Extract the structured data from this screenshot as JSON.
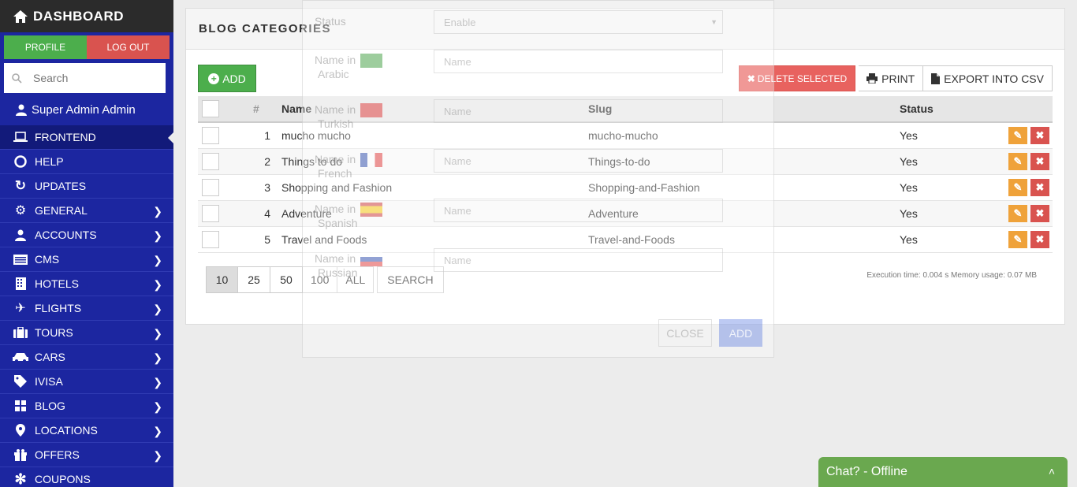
{
  "sidebar": {
    "title": "DASHBOARD",
    "profile_label": "PROFILE",
    "logout_label": "LOG OUT",
    "search_placeholder": "Search",
    "user_name": "Super Admin Admin",
    "items": [
      {
        "label": "FRONTEND",
        "icon": "laptop-icon"
      },
      {
        "label": "HELP",
        "icon": "lifebuoy-icon"
      },
      {
        "label": "UPDATES",
        "icon": "refresh-icon"
      },
      {
        "label": "GENERAL",
        "icon": "gears-icon"
      },
      {
        "label": "ACCOUNTS",
        "icon": "user-icon"
      },
      {
        "label": "CMS",
        "icon": "list-icon"
      },
      {
        "label": "HOTELS",
        "icon": "building-icon"
      },
      {
        "label": "FLIGHTS",
        "icon": "plane-icon"
      },
      {
        "label": "TOURS",
        "icon": "suitcase-icon"
      },
      {
        "label": "CARS",
        "icon": "car-icon"
      },
      {
        "label": "IVISA",
        "icon": "tag-icon"
      },
      {
        "label": "BLOG",
        "icon": "grid-icon"
      },
      {
        "label": "LOCATIONS",
        "icon": "map-marker-icon"
      },
      {
        "label": "OFFERS",
        "icon": "gift-icon"
      },
      {
        "label": "COUPONS",
        "icon": "asterisk-icon"
      }
    ]
  },
  "panel": {
    "title": "BLOG CATEGORIES",
    "add_label": "ADD",
    "delete_selected_label": "DELETE SELECTED",
    "print_label": "PRINT",
    "export_label": "EXPORT INTO CSV",
    "columns": {
      "num": "#",
      "name": "Name",
      "slug": "Slug",
      "status": "Status"
    },
    "rows": [
      {
        "num": "1",
        "name": "mucho mucho",
        "slug": "mucho-mucho",
        "status": "Yes"
      },
      {
        "num": "2",
        "name": "Things to do",
        "slug": "Things-to-do",
        "status": "Yes"
      },
      {
        "num": "3",
        "name": "Shopping and Fashion",
        "slug": "Shopping-and-Fashion",
        "status": "Yes"
      },
      {
        "num": "4",
        "name": "Adventure",
        "slug": "Adventure",
        "status": "Yes"
      },
      {
        "num": "5",
        "name": "Travel and Foods",
        "slug": "Travel-and-Foods",
        "status": "Yes"
      }
    ],
    "pager": [
      "10",
      "25",
      "50",
      "100",
      "ALL"
    ],
    "search_label": "SEARCH",
    "execution": "Execution time: 0.004 s    Memory usage: 0.07 MB"
  },
  "modal": {
    "status_label": "Status",
    "status_value": "Enable",
    "name_in": "Name in",
    "placeholder": "Name",
    "languages": [
      "Arabic",
      "Turkish",
      "French",
      "Spanish",
      "Russian"
    ],
    "close_label": "CLOSE",
    "add_label": "ADD"
  },
  "chat": {
    "label": "Chat? - Offline"
  }
}
